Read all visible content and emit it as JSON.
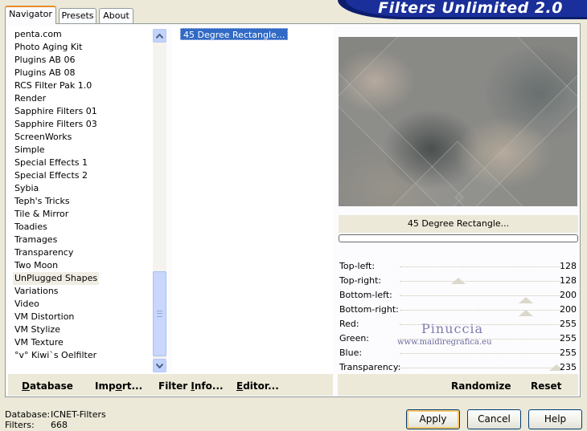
{
  "header": {
    "title": "Filters Unlimited 2.0"
  },
  "tabs": [
    {
      "label": "Navigator",
      "active": true
    },
    {
      "label": "Presets",
      "active": false
    },
    {
      "label": "About",
      "active": false
    }
  ],
  "categories": [
    "penta.com",
    "Photo Aging Kit",
    "Plugins AB 06",
    "Plugins AB 08",
    "RCS Filter Pak 1.0",
    "Render",
    "Sapphire Filters 01",
    "Sapphire Filters 03",
    "ScreenWorks",
    "Simple",
    "Special Effects 1",
    "Special Effects 2",
    "Sybia",
    "Teph's Tricks",
    "Tile & Mirror",
    "Toadies",
    "Tramages",
    "Transparency",
    "Two Moon",
    "UnPlugged Shapes",
    "Variations",
    "Video",
    "VM Distortion",
    "VM Stylize",
    "VM Texture",
    "°v° Kiwi`s Oelfilter"
  ],
  "selected_category": "UnPlugged Shapes",
  "filters": [
    "45 Degree Rectangle..."
  ],
  "preview": {
    "filter_name": "45 Degree Rectangle...",
    "progress_percent": 0
  },
  "parameters": [
    {
      "label": "Top-left:",
      "value": 128
    },
    {
      "label": "Top-right:",
      "value": 128
    },
    {
      "label": "Bottom-left:",
      "value": 200
    },
    {
      "label": "Bottom-right:",
      "value": 200
    },
    {
      "label": "Red:",
      "value": 255
    },
    {
      "label": "Green:",
      "value": 255
    },
    {
      "label": "Blue:",
      "value": 255
    },
    {
      "label": "Transparency:",
      "value": 235
    }
  ],
  "watermark": {
    "name": "Pinuccia",
    "site": "www.maidiregrafica.eu"
  },
  "left_buttons": {
    "database": {
      "u": "D",
      "rest": "atabase"
    },
    "import": {
      "pre": "Imp",
      "u": "o",
      "rest": "rt..."
    },
    "filter_info": {
      "pre": "Filter ",
      "u": "I",
      "rest": "nfo..."
    },
    "editor": {
      "u": "E",
      "rest": "ditor..."
    }
  },
  "right_buttons": {
    "randomize": "Randomize",
    "reset": "Reset"
  },
  "footer": {
    "database_label": "Database:",
    "database_value": "ICNET-Filters",
    "filters_label": "Filters:",
    "filters_value": "668"
  },
  "dialog_buttons": {
    "apply": "Apply",
    "cancel": "Cancel",
    "help": "Help"
  }
}
